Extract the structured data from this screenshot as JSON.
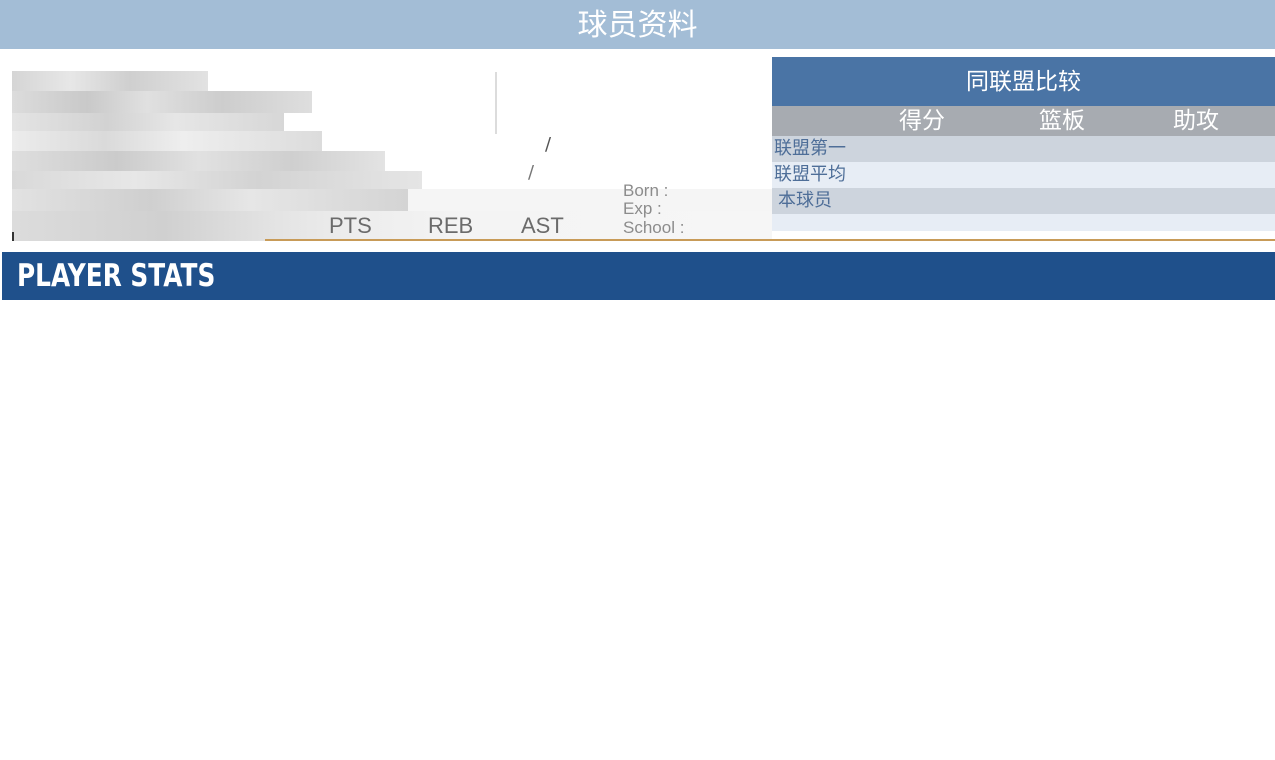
{
  "header": {
    "title": "球员资料"
  },
  "player_card": {
    "stat_labels": [
      "PTS",
      "REB",
      "AST"
    ],
    "info_labels": {
      "born": "Born :",
      "exp": "Exp :",
      "school": "School :"
    },
    "separator": "/"
  },
  "comparison": {
    "title": "同联盟比较",
    "columns": [
      "得分",
      "篮板",
      "助攻"
    ],
    "rows": [
      "联盟第一",
      "联盟平均",
      "本球员"
    ]
  },
  "section": {
    "player_stats_title": "PLAYER STATS"
  },
  "colors": {
    "title_bar": "#a3bdd6",
    "compare_header": "#4a74a5",
    "compare_columns": "#a7abb1",
    "stats_bar": "#1f508b",
    "accent_line": "#c89b58"
  }
}
